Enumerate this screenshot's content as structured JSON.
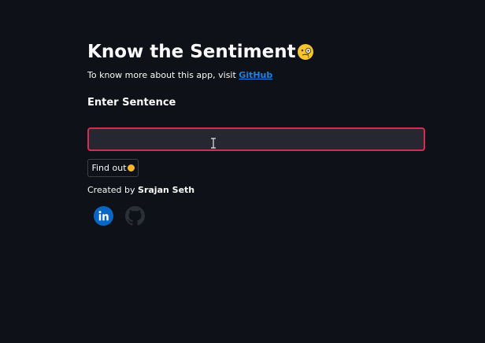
{
  "header": {
    "title": "Know the Sentiment",
    "title_emoji": "face-with-monocle"
  },
  "intro": {
    "text": "To know more about this app, visit ",
    "link_label": "GitHub"
  },
  "form": {
    "label": "Enter Sentence",
    "input_value": "",
    "button_label": "Find out"
  },
  "footer": {
    "created_prefix": "Created by ",
    "author": "Srajan Seth",
    "social_icons": [
      "linkedin-icon",
      "github-icon"
    ]
  },
  "colors": {
    "background": "#0e1117",
    "input_background": "#262730",
    "input_focus_border": "#d03050",
    "link": "#1c83e1",
    "linkedin_blue": "#0a66c2"
  }
}
